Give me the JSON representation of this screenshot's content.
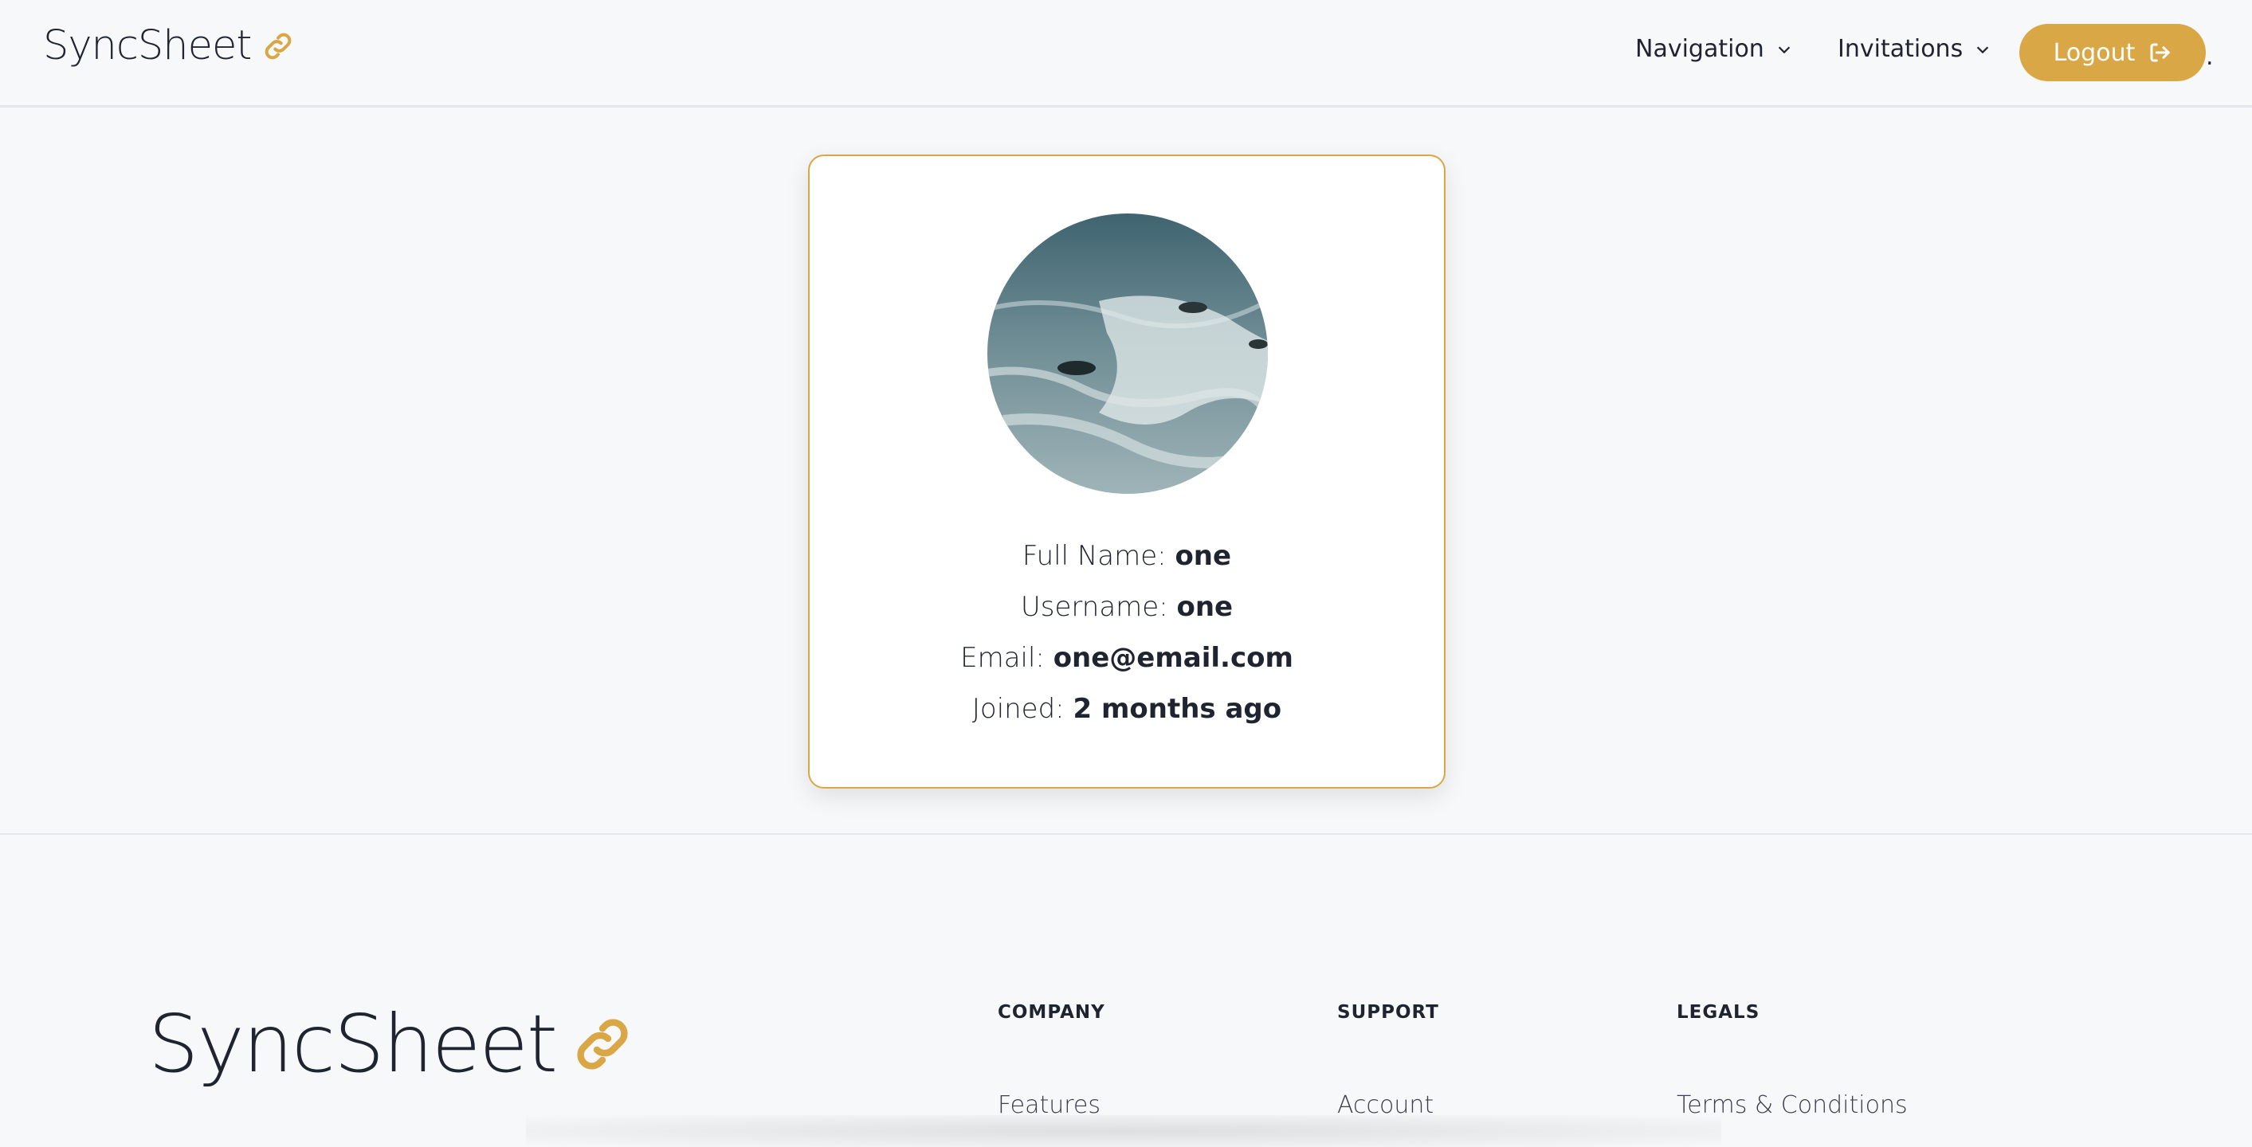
{
  "header": {
    "brand": "SyncSheet",
    "nav": [
      {
        "label": "Navigation"
      },
      {
        "label": "Invitations"
      }
    ],
    "logout_label": "Logout",
    "trailing_dot": "."
  },
  "profile": {
    "avatar_desc_icon": "river-rafting-photo",
    "rows": [
      {
        "label": "Full Name: ",
        "value": "one"
      },
      {
        "label": "Username: ",
        "value": "one"
      },
      {
        "label": "Email: ",
        "value": "one@email.com"
      },
      {
        "label": "Joined: ",
        "value": "2 months ago"
      }
    ]
  },
  "footer": {
    "brand": "SyncSheet",
    "columns": [
      {
        "heading": "COMPANY",
        "links": [
          "Features"
        ]
      },
      {
        "heading": "SUPPORT",
        "links": [
          "Account"
        ]
      },
      {
        "heading": "LEGALS",
        "links": [
          "Terms & Conditions"
        ]
      }
    ]
  },
  "colors": {
    "accent": "#d9a745",
    "text": "#1f2430",
    "background": "#f7f8fa"
  }
}
